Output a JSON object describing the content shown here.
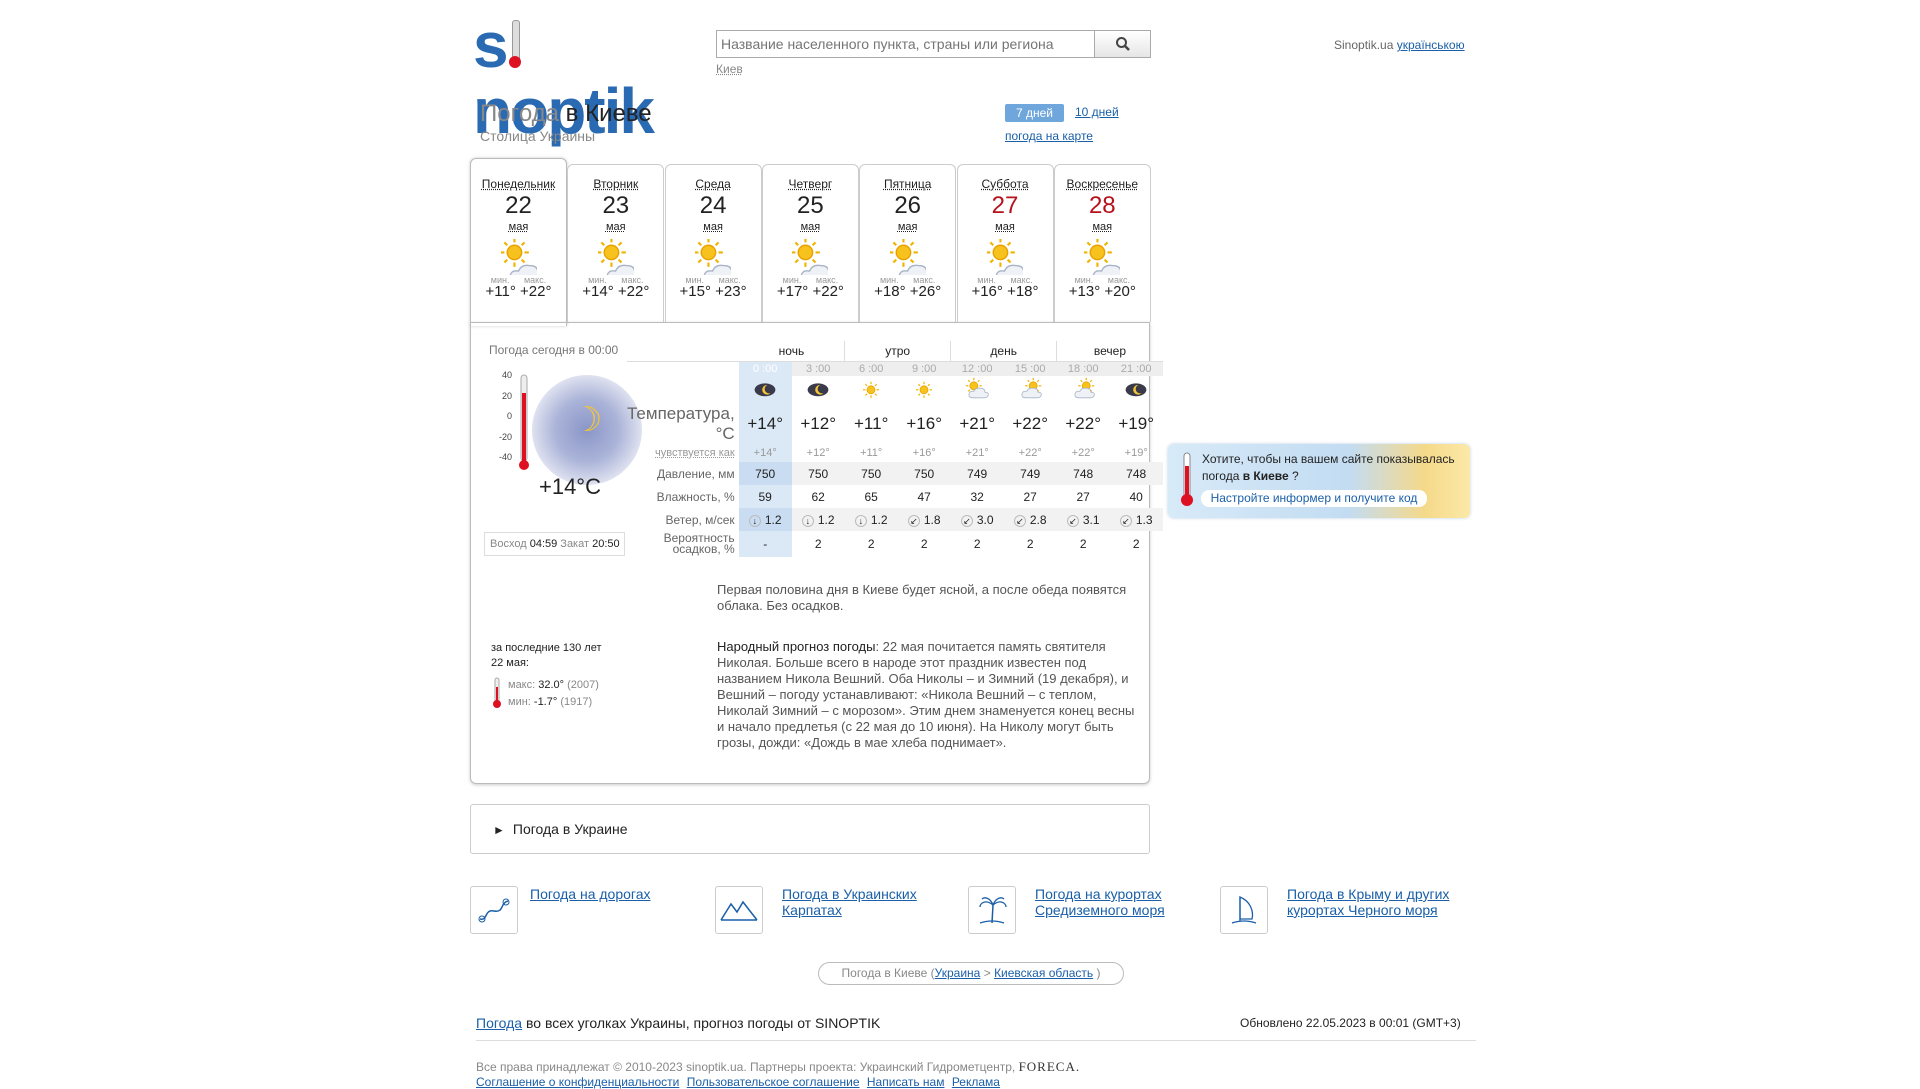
{
  "header": {
    "logo": "sinoptik",
    "search_placeholder": "Название населенного пункта, страны или региона",
    "search_hint": "Киев",
    "site_label": "Sinoptik.ua",
    "lang_link": "українською"
  },
  "title": {
    "prefix": "Погода",
    "suffix": "в Киеве",
    "subtitle": "Столица Украины"
  },
  "tabs": {
    "days7": "7 дней",
    "days10": "10 дней",
    "map": "погода на карте"
  },
  "days": [
    {
      "name": "Понедельник",
      "date": "22",
      "month": "мая",
      "min_label": "мин.",
      "max_label": "макс.",
      "min": "+11°",
      "max": "+22°",
      "weekend": false,
      "active": true
    },
    {
      "name": "Вторник",
      "date": "23",
      "month": "мая",
      "min_label": "мин.",
      "max_label": "макс.",
      "min": "+14°",
      "max": "+22°",
      "weekend": false,
      "active": false
    },
    {
      "name": "Среда",
      "date": "24",
      "month": "мая",
      "min_label": "мин.",
      "max_label": "макс.",
      "min": "+15°",
      "max": "+23°",
      "weekend": false,
      "active": false
    },
    {
      "name": "Четверг",
      "date": "25",
      "month": "мая",
      "min_label": "мин.",
      "max_label": "макс.",
      "min": "+17°",
      "max": "+22°",
      "weekend": false,
      "active": false
    },
    {
      "name": "Пятница",
      "date": "26",
      "month": "мая",
      "min_label": "мин.",
      "max_label": "макс.",
      "min": "+18°",
      "max": "+26°",
      "weekend": false,
      "active": false
    },
    {
      "name": "Суббота",
      "date": "27",
      "month": "мая",
      "min_label": "мин.",
      "max_label": "макс.",
      "min": "+16°",
      "max": "+18°",
      "weekend": true,
      "active": false
    },
    {
      "name": "Воскресенье",
      "date": "28",
      "month": "мая",
      "min_label": "мин.",
      "max_label": "макс.",
      "min": "+13°",
      "max": "+20°",
      "weekend": true,
      "active": false
    }
  ],
  "today": {
    "label": "Погода сегодня в 00:00",
    "scale": [
      "40",
      "20",
      "0",
      "-20",
      "-40"
    ],
    "temp": "+14°C",
    "sunrise_label": "Восход",
    "sunrise": "04:59",
    "sunset_label": "Закат",
    "sunset": "20:50"
  },
  "grid": {
    "periods": [
      "ночь",
      "утро",
      "день",
      "вечер"
    ],
    "times": [
      "0 :00",
      "3 :00",
      "6 :00",
      "9 :00",
      "12 :00",
      "15 :00",
      "18 :00",
      "21 :00"
    ],
    "icons": [
      "moon-cloud",
      "moon-cloud",
      "sun",
      "sun",
      "sun-cloud",
      "cloud-sun",
      "cloud-sun",
      "moon-cloud"
    ],
    "labels": {
      "temp": "Температура, °C",
      "feels": "чувствуется как",
      "pressure": "Давление, мм",
      "humidity": "Влажность, %",
      "wind": "Ветер, м/сек",
      "precip": "Вероятность осадков, %"
    },
    "temp": [
      "+14°",
      "+12°",
      "+11°",
      "+16°",
      "+21°",
      "+22°",
      "+22°",
      "+19°"
    ],
    "feels": [
      "+14°",
      "+12°",
      "+11°",
      "+16°",
      "+21°",
      "+22°",
      "+22°",
      "+19°"
    ],
    "pressure": [
      "750",
      "750",
      "750",
      "750",
      "749",
      "749",
      "748",
      "748"
    ],
    "humidity": [
      "59",
      "62",
      "65",
      "47",
      "32",
      "27",
      "27",
      "40"
    ],
    "wind_dir": [
      "↓",
      "↓",
      "↓",
      "↙",
      "↙",
      "↙",
      "↙",
      "↙"
    ],
    "wind": [
      "1.2",
      "1.2",
      "1.2",
      "1.8",
      "3.0",
      "2.8",
      "3.1",
      "1.3"
    ],
    "precip": [
      "-",
      "2",
      "2",
      "2",
      "2",
      "2",
      "2",
      "2"
    ]
  },
  "description": "Первая половина дня в Киеве будет ясной, а после обеда появятся облака. Без осадков.",
  "folk": {
    "title": "Народный прогноз погоды",
    "text": ": 22 мая почитается память святителя Николая. Больше всего в народе этот праздник известен под названием Никола Вешний. Оба Николы – и Зимний (19 декабря), и Вешний – погоду устанавливают: «Никола Вешний – с теплом, Николай Зимний – с морозом». Этим днем знаменуется конец весны и начало предлетья (с 22 мая до 10 июня). На Николу могут быть грозы, дожди: «Дождь в мае хлеба поднимает»."
  },
  "history": {
    "line1": "за последние 130 лет",
    "line2": "22 мая:",
    "max_label": "макс:",
    "max": "32.0°",
    "max_year": "(2007)",
    "min_label": "мин:",
    "min": "-1.7°",
    "min_year": "(1917)"
  },
  "promo": {
    "text1": "Хотите, чтобы на вашем сайте показывалась погода ",
    "city": "в Киеве",
    "text2": " ?",
    "button": "Настройте информер и получите код"
  },
  "ukraine": {
    "arrow": "►",
    "label": "Погода в Украине"
  },
  "links": [
    {
      "label": "Погода на дорогах",
      "icon": "road-icon"
    },
    {
      "label": "Погода в Украинских Карпатах",
      "icon": "mountains-icon"
    },
    {
      "label": "Погода на курортах Средиземного моря",
      "icon": "palm-icon"
    },
    {
      "label": "Погода в Крыму и других курортах Черного моря",
      "icon": "sail-icon"
    }
  ],
  "breadcrumb": {
    "prefix": "Погода в Киеве (",
    "country": "Украина",
    "sep": ">",
    "region": "Киевская область",
    "suffix": ")"
  },
  "footer": {
    "link": "Погода",
    "text": " во всех уголках Украины, прогноз погоды от SINOPTIK",
    "updated": "Обновлено 22.05.2023 в 00:01 (GMT+3)",
    "copyright": "Все права принадлежат © 2010-2023 sinoptik.ua. Партнеры проекта: Украинский Гидрометцентр,",
    "partner": "FORECA.",
    "privacy": "Соглашение о конфиденциальности",
    "terms": "Пользовательское соглашение",
    "contact": "Написать нам",
    "ads": "Реклама"
  }
}
